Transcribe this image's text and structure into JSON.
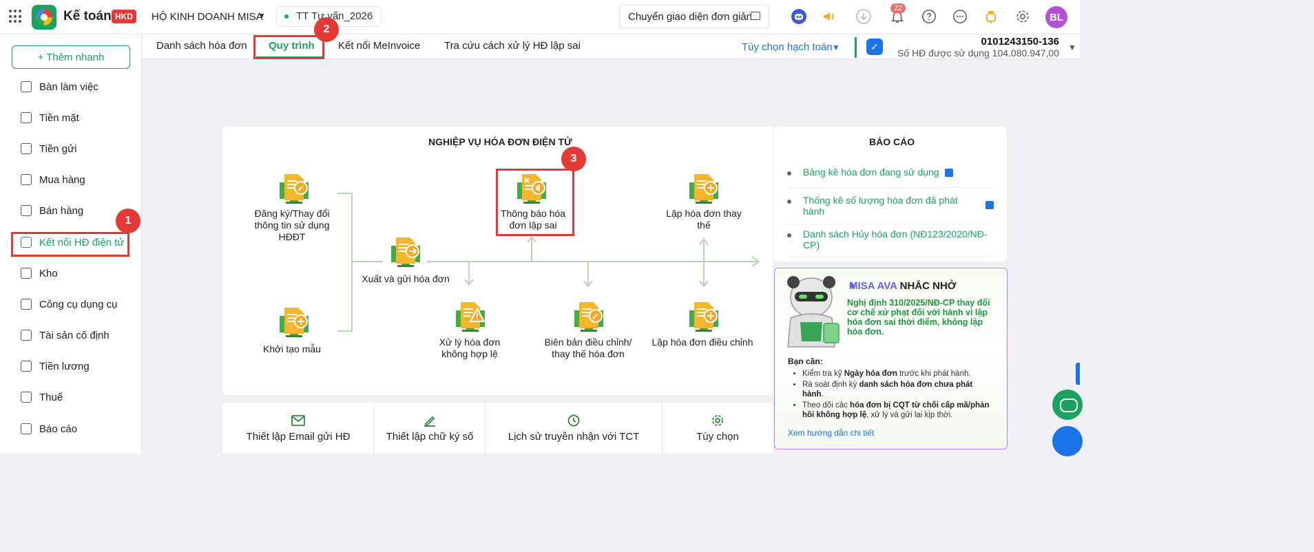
{
  "header": {
    "app_name": "Kế toán",
    "app_badge": "HKD",
    "company": "HỘ KINH DOANH MISA",
    "period": "TT Tư vấn_2026",
    "switch_ui_label": "Chuyển giao diện đơn giản",
    "notification_count": "22",
    "avatar_initials": "BL"
  },
  "sidebar": {
    "quick_add": "+ Thêm nhanh",
    "items": [
      {
        "label": "Bàn làm việc",
        "icon": "dashboard-icon"
      },
      {
        "label": "Tiền mặt",
        "icon": "wallet-icon"
      },
      {
        "label": "Tiền gửi",
        "icon": "card-icon"
      },
      {
        "label": "Mua hàng",
        "icon": "cart-icon"
      },
      {
        "label": "Bán hàng",
        "icon": "tag-icon"
      },
      {
        "label": "Kết nối HĐ điện tử",
        "icon": "invoice-check-icon",
        "active": true
      },
      {
        "label": "Kho",
        "icon": "box-icon"
      },
      {
        "label": "Công cụ dụng cụ",
        "icon": "wrench-icon"
      },
      {
        "label": "Tài sản cố định",
        "icon": "truck-icon"
      },
      {
        "label": "Tiền lương",
        "icon": "money-icon"
      },
      {
        "label": "Thuế",
        "icon": "receipt-icon"
      },
      {
        "label": "Báo cáo",
        "icon": "chart-icon"
      }
    ]
  },
  "tabs": {
    "items": [
      "Danh sách hóa đơn",
      "Quy trình",
      "Kết nối MeInvoice",
      "Tra cứu cách xử lý HĐ lập sai"
    ],
    "active_index": 1,
    "accounting_option": "Tùy chọn hạch toán",
    "tax_code": "0101243150-136",
    "invoice_count": "Số HĐ được sử dụng 104.080.947,00"
  },
  "steps": [
    "1",
    "2",
    "3"
  ],
  "workflow": {
    "title": "NGHIỆP VỤ HÓA ĐƠN ĐIỆN TỬ",
    "nodes": {
      "register": "Đăng ký/Thay đổi thông tin sử dụng HĐĐT",
      "template": "Khởi tạo mẫu",
      "issue": "Xuất và gửi hóa đơn",
      "notify_wrong": "Thông báo hóa đơn lập sai",
      "replace": "Lập hóa đơn thay thế",
      "invalid": "Xử lý hóa đơn không hợp lệ",
      "minutes": "Biên bản điều chỉnh/ thay thế hóa đơn",
      "adjust": "Lập hóa đơn điều chỉnh"
    }
  },
  "reports": {
    "title": "BÁO CÁO",
    "items": [
      "Bảng kê hóa đơn đang sử dụng",
      "Thống kê số lượng hóa đơn đã phát hành",
      "Danh sách Hủy hóa đơn (NĐ123/2020/NĐ-CP)"
    ]
  },
  "ava": {
    "brand": "MISA AVA",
    "title_suffix": " NHẮC NHỞ",
    "decree": "Nghị định 310/2025/NĐ-CP thay đổi cơ chế xử phạt đối với hành vi lập hóa đơn sai thời điểm, không lập hóa đơn.",
    "need_label": "Bạn cần:",
    "tip1_pre": "Kiểm tra kỹ ",
    "tip1_bold": "Ngày hóa đơn",
    "tip1_post": " trước khi phát hành.",
    "tip2_pre": "Rà soát định kỳ ",
    "tip2_bold": "danh sách hóa đơn chưa phát hành",
    "tip2_post": ".",
    "tip3_pre": "Theo dõi các ",
    "tip3_bold": "hóa đơn bị CQT từ chối cấp mã/phản hồi không hợp lệ",
    "tip3_post": ", xử lý và gửi lại kịp thời.",
    "guide_link": "Xem hướng dẫn chi tiết"
  },
  "bottom_toolbar": {
    "email": "Thiết lập Email gửi HĐ",
    "signature": "Thiết lập chữ ký số",
    "history": "Lịch sử truyền nhận với TCT",
    "options": "Tùy chọn"
  },
  "colors": {
    "primary": "#1aa260",
    "accent_blue": "#1a73e8",
    "highlight_red": "#e53935",
    "avatar": "#b44fd8",
    "ava_purple": "#6b5cf0"
  }
}
